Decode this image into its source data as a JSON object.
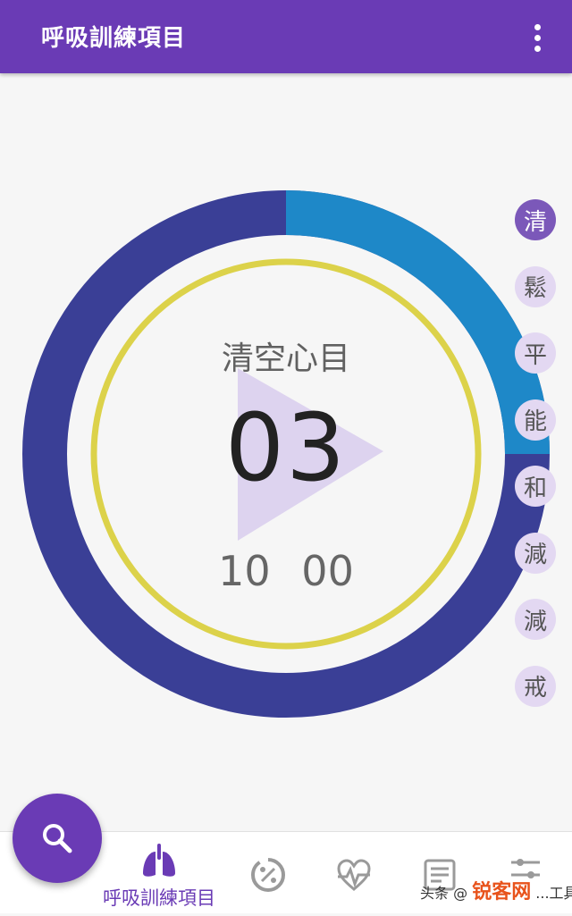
{
  "appbar": {
    "title": "呼吸訓練項目",
    "menu_icon": "more-vert-icon"
  },
  "exercise": {
    "name": "清空心目",
    "count": "03",
    "time": "10 00"
  },
  "timer": {
    "outer_ring_progress": 0.375,
    "colors": {
      "ring_track": "#3a3f96",
      "ring_progress": "#1e88c8",
      "inner_ring": "#dcd24a",
      "play": "#ddd3ef"
    }
  },
  "side_list": {
    "items": [
      "清",
      "鬆",
      "平",
      "能",
      "和",
      "減",
      "減",
      "戒"
    ],
    "active_index": 0
  },
  "fab": {
    "icon": "search-icon"
  },
  "bottom_nav": {
    "items": [
      {
        "label": "呼吸訓練項目",
        "icon": "lungs-icon",
        "active": true
      },
      {
        "label": "",
        "icon": "percent-gauge-icon",
        "active": false
      },
      {
        "label": "",
        "icon": "heart-pulse-icon",
        "active": false
      },
      {
        "label": "",
        "icon": "notes-icon",
        "active": false
      },
      {
        "label": "",
        "icon": "sliders-icon",
        "active": false
      }
    ]
  },
  "watermark": {
    "prefix": "头条 @",
    "middle": "...工具了",
    "brand": "锐客网"
  },
  "colors": {
    "primary": "#6a3bb5",
    "background": "#f6f6f6"
  }
}
